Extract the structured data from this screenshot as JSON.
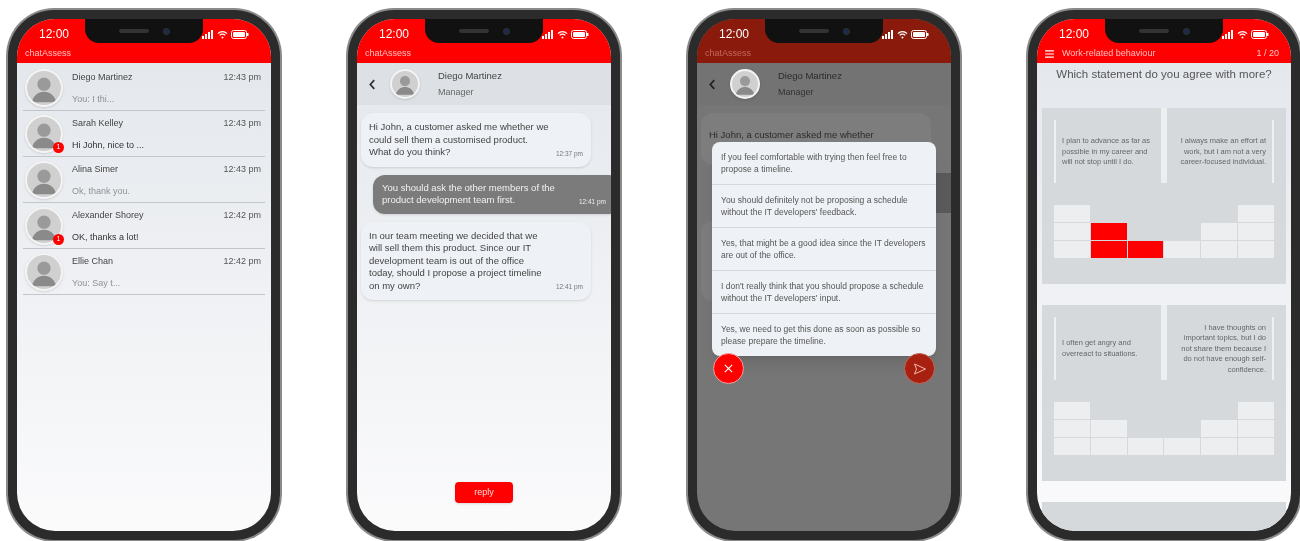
{
  "phones": [
    {
      "kind": "chat_list",
      "status_time": "12:00",
      "app_title": "chatAssess",
      "chats": [
        {
          "name": "Diego Martinez",
          "time": "12:43 pm",
          "preview": "You: I thi...",
          "unread": false
        },
        {
          "name": "Sarah Kelley",
          "time": "12:43 pm",
          "preview": "Hi John, nice to ...",
          "unread": true,
          "badge": "1"
        },
        {
          "name": "Alina Simer",
          "time": "12:43 pm",
          "preview": "Ok, thank you.",
          "unread": false
        },
        {
          "name": "Alexander Shorey",
          "time": "12:42 pm",
          "preview": "OK, thanks a lot!",
          "unread": true,
          "badge": "1"
        },
        {
          "name": "Ellie Chan",
          "time": "12:42 pm",
          "preview": "You: Say t...",
          "unread": false
        }
      ]
    },
    {
      "kind": "chat",
      "status_time": "12:00",
      "app_title": "chatAssess",
      "contact": {
        "name": "Diego Martinez",
        "role": "Manager"
      },
      "messages": [
        {
          "kind": "incoming",
          "text": "Hi John, a customer asked me whether we could sell them a customised product. What do you think?",
          "time": "12:37 pm"
        },
        {
          "kind": "outgoing",
          "text": "You should ask the other members of the product development team first.",
          "time": "12:41 pm"
        },
        {
          "kind": "incoming",
          "text": "In our team meeting we decided that we will sell them this product. Since our IT development team is out of the office today, should I propose a project timeline on my own?",
          "time": "12:41 pm"
        }
      ],
      "reply_button": "reply"
    },
    {
      "kind": "reply_options",
      "status_time": "12:00",
      "app_title": "chatAssess",
      "contact": {
        "name": "Diego Martinez",
        "role": "Manager"
      },
      "background_message": "Hi John, a customer asked me whether",
      "options": [
        "If you feel comfortable with trying then feel free to propose a timeline.",
        "You should definitely not be proposing a schedule without the IT developers' feedback.",
        "Yes, that might be a good idea since the IT developers are out of the office.",
        "I don't really think that you should propose a schedule without the IT developers' input.",
        "Yes, we need to get this done as soon as possible so please prepare the timeline."
      ]
    },
    {
      "kind": "questionnaire",
      "status_time": "12:00",
      "title": "Work-related behaviour",
      "progress": "1 / 20",
      "question": "Which statement do you agree with more?",
      "statements": [
        {
          "left": "I plan to advance as far as possible in my career and will not stop until I do.",
          "right": "I always make an effort at work, but I am not a very career-focused individual.",
          "scale": [
            {
              "filled": false
            },
            {
              "filled": true
            },
            {
              "filled": true
            },
            {
              "filled": false
            },
            {
              "filled": false
            },
            {
              "filled": false
            }
          ]
        },
        {
          "left": "I often get angry and overreact to situations.",
          "right": "I have thoughts on important topics, but I do not share them because I do not have enough self-confidence.",
          "scale": [
            {
              "filled": false
            },
            {
              "filled": false
            },
            {
              "filled": false
            },
            {
              "filled": false
            },
            {
              "filled": false
            },
            {
              "filled": false
            }
          ]
        }
      ]
    }
  ]
}
